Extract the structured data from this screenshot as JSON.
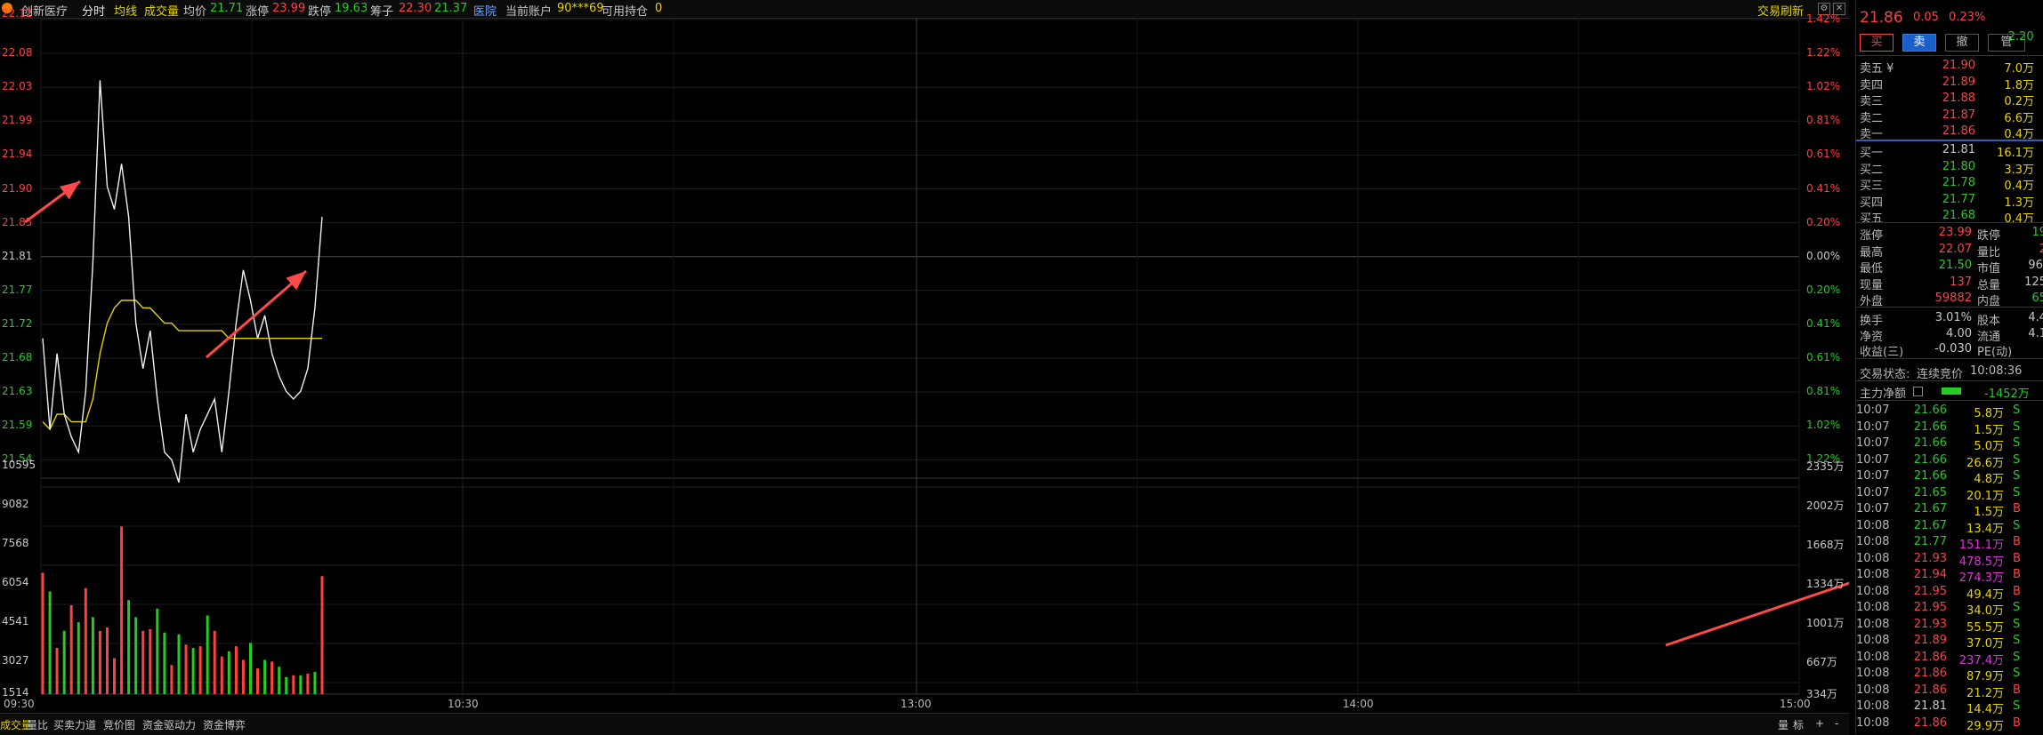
{
  "header": {
    "stock_name": "创新医疗",
    "tab_intraday": "分时",
    "label_avg_line": "均线",
    "label_volume": "成交量",
    "label_avg_price": "均价",
    "avg_price": "21.71",
    "label_limit_up": "涨停",
    "limit_up": "23.99",
    "label_limit_down": "跌停",
    "limit_down": "19.63",
    "label_chips": "筹子",
    "chips_low": "22.30",
    "chips_high": "21.37",
    "sector": "医院",
    "label_account": "当前账户",
    "account": "90***69",
    "label_holding": "可用持仓",
    "holding": "0",
    "refresh_button": "交易刷新"
  },
  "price_axis_left": [
    "22.12",
    "22.08",
    "22.03",
    "21.99",
    "21.94",
    "21.90",
    "21.85",
    "21.81",
    "21.77",
    "21.72",
    "21.68",
    "21.63",
    "21.59",
    "21.54"
  ],
  "price_axis_right": [
    "1.42%",
    "1.22%",
    "1.02%",
    "0.81%",
    "0.61%",
    "0.41%",
    "0.20%",
    "0.00%",
    "0.20%",
    "0.41%",
    "0.61%",
    "0.81%",
    "1.02%",
    "1.22%"
  ],
  "volume_axis_left": [
    "10595",
    "9082",
    "7568",
    "6054",
    "4541",
    "3027",
    "1514"
  ],
  "volume_axis_right": [
    "2335万",
    "2002万",
    "1668万",
    "1334万",
    "1001万",
    "667万",
    "334万"
  ],
  "time_axis": [
    "09:30",
    "10:30",
    "13:00",
    "14:00",
    "15:00"
  ],
  "chart_data": {
    "type": "line",
    "title": "",
    "prev_close": 21.81,
    "price_range": [
      21.5,
      22.12
    ],
    "volume_range": [
      0,
      12109
    ],
    "price_series": [
      21.7,
      21.58,
      21.68,
      21.6,
      21.57,
      21.55,
      21.63,
      21.8,
      22.04,
      21.9,
      21.87,
      21.93,
      21.86,
      21.72,
      21.66,
      21.71,
      21.62,
      21.55,
      21.54,
      21.51,
      21.6,
      21.55,
      21.58,
      21.6,
      21.62,
      21.55,
      21.63,
      21.72,
      21.79,
      21.75,
      21.7,
      21.73,
      21.68,
      21.65,
      21.63,
      21.62,
      21.63,
      21.66,
      21.74,
      21.86
    ],
    "avg_series": [
      21.59,
      21.58,
      21.6,
      21.6,
      21.59,
      21.59,
      21.59,
      21.62,
      21.68,
      21.72,
      21.74,
      21.75,
      21.75,
      21.75,
      21.74,
      21.74,
      21.73,
      21.72,
      21.72,
      21.71,
      21.71,
      21.71,
      21.71,
      21.71,
      21.71,
      21.71,
      21.7,
      21.7,
      21.7,
      21.7,
      21.7,
      21.7,
      21.7,
      21.7,
      21.7,
      21.7,
      21.7,
      21.7,
      21.7,
      21.7
    ],
    "volume_series": [
      7100,
      6000,
      2700,
      3700,
      5200,
      4200,
      6200,
      4500,
      3700,
      3900,
      2100,
      9800,
      5500,
      4500,
      3700,
      3800,
      5000,
      3600,
      1700,
      3500,
      2900,
      2700,
      2800,
      4600,
      3700,
      2200,
      2500,
      2800,
      2000,
      3000,
      1500,
      2000,
      1900,
      1600,
      1000,
      1100,
      1100,
      1200,
      1300,
      6900
    ],
    "volume_up": [
      true,
      false,
      true,
      false,
      true,
      false,
      true,
      false,
      true,
      true,
      true,
      true,
      false,
      false,
      true,
      true,
      false,
      false,
      true,
      false,
      true,
      false,
      true,
      false,
      true,
      true,
      false,
      true,
      true,
      false,
      true,
      false,
      true,
      false,
      false,
      true,
      false,
      true,
      false,
      true
    ]
  },
  "panel": {
    "price": "21.86",
    "change": "0.05",
    "change_pct": "0.23%",
    "corner_value": "-2.20",
    "buttons": [
      "买",
      "卖",
      "撤",
      "管"
    ],
    "asks": [
      {
        "label": "卖五 ¥",
        "price": "21.90",
        "vol": "7.0万"
      },
      {
        "label": "卖四",
        "price": "21.89",
        "vol": "1.8万"
      },
      {
        "label": "卖三",
        "price": "21.88",
        "vol": "0.2万"
      },
      {
        "label": "卖二",
        "price": "21.87",
        "vol": "6.6万"
      },
      {
        "label": "卖一",
        "price": "21.86",
        "vol": "0.4万"
      }
    ],
    "bids": [
      {
        "label": "买一",
        "price": "21.81",
        "vol": "16.1万"
      },
      {
        "label": "买二",
        "price": "21.80",
        "vol": "3.3万"
      },
      {
        "label": "买三",
        "price": "21.78",
        "vol": "0.4万"
      },
      {
        "label": "买四",
        "price": "21.77",
        "vol": "1.3万"
      },
      {
        "label": "买五",
        "price": "21.68",
        "vol": "0.4万"
      }
    ],
    "stats": [
      {
        "l1": "涨停",
        "v1": "23.99",
        "l2": "跌停",
        "v2": "19"
      },
      {
        "l1": "最高",
        "v1": "22.07",
        "l2": "量比",
        "v2": "2"
      },
      {
        "l1": "最低",
        "v1": "21.50",
        "l2": "市值",
        "v2": "96."
      },
      {
        "l1": "现量",
        "v1": "137",
        "l2": "总量",
        "v2": "125"
      },
      {
        "l1": "外盘",
        "v1": "59882",
        "l2": "内盘",
        "v2": "65"
      }
    ],
    "fundamentals": [
      {
        "l1": "换手",
        "v1": "3.01%",
        "l2": "股本",
        "v2": "4.4"
      },
      {
        "l1": "净资",
        "v1": "4.00",
        "l2": "流通",
        "v2": "4.1"
      },
      {
        "l1": "收益(三)",
        "v1": "-0.030",
        "l2": "PE(动)",
        "v2": ""
      }
    ],
    "trade_status_label": "交易状态:",
    "trade_status": "连续竞价",
    "trade_time": "10:08:36",
    "main_net_label": "主力净额",
    "main_net_value": "-1452万",
    "ticks": [
      {
        "t": "10:07",
        "p": "21.66",
        "v": "5.8万",
        "d": "S"
      },
      {
        "t": "10:07",
        "p": "21.66",
        "v": "1.5万",
        "d": "S"
      },
      {
        "t": "10:07",
        "p": "21.66",
        "v": "5.0万",
        "d": "S"
      },
      {
        "t": "10:07",
        "p": "21.66",
        "v": "26.6万",
        "d": "S"
      },
      {
        "t": "10:07",
        "p": "21.66",
        "v": "4.8万",
        "d": "S"
      },
      {
        "t": "10:07",
        "p": "21.65",
        "v": "20.1万",
        "d": "S"
      },
      {
        "t": "10:07",
        "p": "21.67",
        "v": "1.5万",
        "d": "B"
      },
      {
        "t": "10:08",
        "p": "21.67",
        "v": "13.4万",
        "d": "S"
      },
      {
        "t": "10:08",
        "p": "21.77",
        "v": "151.1万",
        "d": "B"
      },
      {
        "t": "10:08",
        "p": "21.93",
        "v": "478.5万",
        "d": "B"
      },
      {
        "t": "10:08",
        "p": "21.94",
        "v": "274.3万",
        "d": "B"
      },
      {
        "t": "10:08",
        "p": "21.95",
        "v": "49.4万",
        "d": "B"
      },
      {
        "t": "10:08",
        "p": "21.95",
        "v": "34.0万",
        "d": "S"
      },
      {
        "t": "10:08",
        "p": "21.93",
        "v": "55.5万",
        "d": "S"
      },
      {
        "t": "10:08",
        "p": "21.89",
        "v": "37.0万",
        "d": "S"
      },
      {
        "t": "10:08",
        "p": "21.86",
        "v": "237.4万",
        "d": "S"
      },
      {
        "t": "10:08",
        "p": "21.86",
        "v": "87.9万",
        "d": "S"
      },
      {
        "t": "10:08",
        "p": "21.86",
        "v": "21.2万",
        "d": "B"
      },
      {
        "t": "10:08",
        "p": "21.81",
        "v": "14.4万",
        "d": "S"
      },
      {
        "t": "10:08",
        "p": "21.86",
        "v": "29.9万",
        "d": "B"
      }
    ]
  },
  "bottom_tabs": [
    "成交量",
    "量比",
    "买卖力道",
    "竞价图",
    "资金驱动力",
    "资金博弈"
  ],
  "bottom_right": [
    "量",
    "标",
    "+",
    "-"
  ],
  "colors": {
    "up": "#ff4040",
    "down": "#22cc22",
    "avg": "#e6d200",
    "annotation": "#ff4a4a",
    "grid": "#1f1f1f"
  }
}
